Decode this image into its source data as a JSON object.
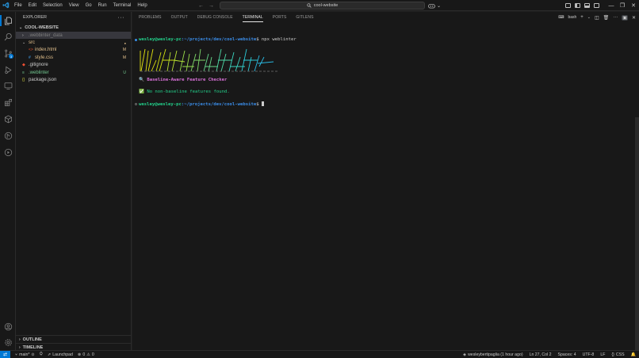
{
  "menu": [
    "File",
    "Edit",
    "Selection",
    "View",
    "Go",
    "Run",
    "Terminal",
    "Help"
  ],
  "command_center": {
    "label": "cool-website"
  },
  "explorer": {
    "title": "EXPLORER",
    "root": "COOL-WEBSITE",
    "items": [
      {
        "label": ".webbinter_data",
        "kind": "folder",
        "indent": 1,
        "color": "#7f7f7f",
        "status": "",
        "status_color": ""
      },
      {
        "label": "src",
        "kind": "folder-open",
        "indent": 1,
        "color": "#e2c08d",
        "status": "",
        "status_color": "#e2c08d"
      },
      {
        "label": "index.html",
        "kind": "html",
        "indent": 2,
        "color": "#e2c08d",
        "status": "M",
        "status_color": "#e2c08d"
      },
      {
        "label": "style.css",
        "kind": "css",
        "indent": 2,
        "color": "#e2c08d",
        "status": "M",
        "status_color": "#e2c08d"
      },
      {
        "label": ".gitignore",
        "kind": "git",
        "indent": 1,
        "color": "#cccccc",
        "status": "",
        "status_color": ""
      },
      {
        "label": ".weblinter",
        "kind": "file",
        "indent": 1,
        "color": "#73c991",
        "status": "U",
        "status_color": "#73c991"
      },
      {
        "label": "package.json",
        "kind": "json",
        "indent": 1,
        "color": "#cccccc",
        "status": "",
        "status_color": ""
      }
    ],
    "outline": "OUTLINE",
    "timeline": "TIMELINE"
  },
  "panel": {
    "tabs": [
      "PROBLEMS",
      "OUTPUT",
      "DEBUG CONSOLE",
      "TERMINAL",
      "PORTS",
      "GITLENS"
    ],
    "active_tab": "TERMINAL",
    "shell": "bash"
  },
  "terminal": {
    "prompt_user": "wesley@wesley-pc",
    "prompt_path": ":~/projects/dev/cool-website",
    "command": "$ npx weblinter",
    "heading": "🔍 Baseline-Aware Feature Checker",
    "result": "✅ No non-baseline features found.",
    "second_prompt_suffix": "$ "
  },
  "statusbar": {
    "branch": "main*",
    "launchpad": "Launchpad",
    "errors": "0",
    "warnings": "0",
    "blame": "wesleybertipaglia (1 hour ago)",
    "cursor": "Ln 27, Col 2",
    "spaces": "Spaces: 4",
    "encoding": "UTF-8",
    "eol": "LF",
    "language": "CSS"
  },
  "colors": {
    "accent": "#0078d4",
    "prompt_user": "#23d18b",
    "prompt_path": "#3b8eea",
    "heading": "#d670d6",
    "result": "#23d18b"
  }
}
